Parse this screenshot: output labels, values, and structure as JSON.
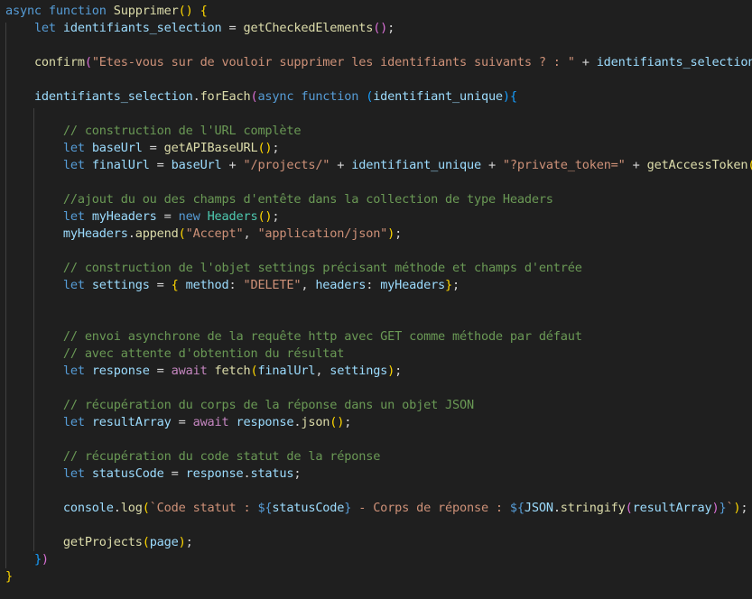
{
  "theme": {
    "background": "#1f1f1f",
    "keyword": "#569cd6",
    "control": "#c586c0",
    "function": "#dcdcaa",
    "variable": "#9cdcfe",
    "string": "#ce9178",
    "comment": "#6a9955",
    "class": "#4ec9b0",
    "bracket_1": "#ffd700",
    "bracket_2": "#da70d6",
    "bracket_3": "#179fff"
  },
  "code": {
    "lines": [
      {
        "indent": 0,
        "tokens": [
          {
            "t": "async",
            "c": "kw"
          },
          {
            "t": " "
          },
          {
            "t": "function",
            "c": "kw"
          },
          {
            "t": " "
          },
          {
            "t": "Supprimer",
            "c": "fn"
          },
          {
            "t": "()",
            "c": "b1"
          },
          {
            "t": " "
          },
          {
            "t": "{",
            "c": "b1"
          }
        ]
      },
      {
        "indent": 1,
        "tokens": [
          {
            "t": "let",
            "c": "kw"
          },
          {
            "t": " "
          },
          {
            "t": "identifiants_selection",
            "c": "var"
          },
          {
            "t": " = "
          },
          {
            "t": "getCheckedElements",
            "c": "fn"
          },
          {
            "t": "()",
            "c": "b2"
          },
          {
            "t": ";"
          }
        ]
      },
      {
        "indent": 0,
        "tokens": []
      },
      {
        "indent": 1,
        "tokens": [
          {
            "t": "confirm",
            "c": "fn"
          },
          {
            "t": "(",
            "c": "b2"
          },
          {
            "t": "\"Etes-vous sur de vouloir supprimer les identifiants suivants ? : \"",
            "c": "str"
          },
          {
            "t": " + "
          },
          {
            "t": "identifiants_selection",
            "c": "var"
          },
          {
            "t": ")",
            "c": "b2"
          },
          {
            "t": ";"
          }
        ]
      },
      {
        "indent": 0,
        "tokens": []
      },
      {
        "indent": 1,
        "tokens": [
          {
            "t": "identifiants_selection",
            "c": "var"
          },
          {
            "t": "."
          },
          {
            "t": "forEach",
            "c": "fn"
          },
          {
            "t": "(",
            "c": "b2"
          },
          {
            "t": "async",
            "c": "kw"
          },
          {
            "t": " "
          },
          {
            "t": "function",
            "c": "kw"
          },
          {
            "t": " "
          },
          {
            "t": "(",
            "c": "b3"
          },
          {
            "t": "identifiant_unique",
            "c": "var"
          },
          {
            "t": ")",
            "c": "b3"
          },
          {
            "t": "{",
            "c": "b3"
          }
        ]
      },
      {
        "indent": 0,
        "tokens": []
      },
      {
        "indent": 2,
        "tokens": [
          {
            "t": "// construction de l'URL complète",
            "c": "cm"
          }
        ]
      },
      {
        "indent": 2,
        "tokens": [
          {
            "t": "let",
            "c": "kw"
          },
          {
            "t": " "
          },
          {
            "t": "baseUrl",
            "c": "var"
          },
          {
            "t": " = "
          },
          {
            "t": "getAPIBaseURL",
            "c": "fn"
          },
          {
            "t": "()",
            "c": "b1"
          },
          {
            "t": ";"
          }
        ]
      },
      {
        "indent": 2,
        "tokens": [
          {
            "t": "let",
            "c": "kw"
          },
          {
            "t": " "
          },
          {
            "t": "finalUrl",
            "c": "var"
          },
          {
            "t": " = "
          },
          {
            "t": "baseUrl",
            "c": "var"
          },
          {
            "t": " + "
          },
          {
            "t": "\"/projects/\"",
            "c": "str"
          },
          {
            "t": " + "
          },
          {
            "t": "identifiant_unique",
            "c": "var"
          },
          {
            "t": " + "
          },
          {
            "t": "\"?private_token=\"",
            "c": "str"
          },
          {
            "t": " + "
          },
          {
            "t": "getAccessToken",
            "c": "fn"
          },
          {
            "t": "()",
            "c": "b1"
          },
          {
            "t": ";"
          }
        ]
      },
      {
        "indent": 0,
        "tokens": []
      },
      {
        "indent": 2,
        "tokens": [
          {
            "t": "//ajout du ou des champs d'entête dans la collection de type Headers",
            "c": "cm"
          }
        ]
      },
      {
        "indent": 2,
        "tokens": [
          {
            "t": "let",
            "c": "kw"
          },
          {
            "t": " "
          },
          {
            "t": "myHeaders",
            "c": "var"
          },
          {
            "t": " = "
          },
          {
            "t": "new",
            "c": "kw"
          },
          {
            "t": " "
          },
          {
            "t": "Headers",
            "c": "cls"
          },
          {
            "t": "()",
            "c": "b1"
          },
          {
            "t": ";"
          }
        ]
      },
      {
        "indent": 2,
        "tokens": [
          {
            "t": "myHeaders",
            "c": "var"
          },
          {
            "t": "."
          },
          {
            "t": "append",
            "c": "fn"
          },
          {
            "t": "(",
            "c": "b1"
          },
          {
            "t": "\"Accept\"",
            "c": "str"
          },
          {
            "t": ", "
          },
          {
            "t": "\"application/json\"",
            "c": "str"
          },
          {
            "t": ")",
            "c": "b1"
          },
          {
            "t": ";"
          }
        ]
      },
      {
        "indent": 0,
        "tokens": []
      },
      {
        "indent": 2,
        "tokens": [
          {
            "t": "// construction de l'objet settings précisant méthode et champs d'entrée",
            "c": "cm"
          }
        ]
      },
      {
        "indent": 2,
        "tokens": [
          {
            "t": "let",
            "c": "kw"
          },
          {
            "t": " "
          },
          {
            "t": "settings",
            "c": "var"
          },
          {
            "t": " = "
          },
          {
            "t": "{",
            "c": "b1"
          },
          {
            "t": " "
          },
          {
            "t": "method",
            "c": "var"
          },
          {
            "t": ": "
          },
          {
            "t": "\"DELETE\"",
            "c": "str"
          },
          {
            "t": ", "
          },
          {
            "t": "headers",
            "c": "var"
          },
          {
            "t": ": "
          },
          {
            "t": "myHeaders",
            "c": "var"
          },
          {
            "t": "}",
            "c": "b1"
          },
          {
            "t": ";"
          }
        ]
      },
      {
        "indent": 0,
        "tokens": []
      },
      {
        "indent": 0,
        "tokens": []
      },
      {
        "indent": 2,
        "tokens": [
          {
            "t": "// envoi asynchrone de la requête http avec GET comme méthode par défaut",
            "c": "cm"
          }
        ]
      },
      {
        "indent": 2,
        "tokens": [
          {
            "t": "// avec attente d'obtention du résultat",
            "c": "cm"
          }
        ]
      },
      {
        "indent": 2,
        "tokens": [
          {
            "t": "let",
            "c": "kw"
          },
          {
            "t": " "
          },
          {
            "t": "response",
            "c": "var"
          },
          {
            "t": " = "
          },
          {
            "t": "await",
            "c": "kc"
          },
          {
            "t": " "
          },
          {
            "t": "fetch",
            "c": "fn"
          },
          {
            "t": "(",
            "c": "b1"
          },
          {
            "t": "finalUrl",
            "c": "var"
          },
          {
            "t": ", "
          },
          {
            "t": "settings",
            "c": "var"
          },
          {
            "t": ")",
            "c": "b1"
          },
          {
            "t": ";"
          }
        ]
      },
      {
        "indent": 0,
        "tokens": []
      },
      {
        "indent": 2,
        "tokens": [
          {
            "t": "// récupération du corps de la réponse dans un objet JSON",
            "c": "cm"
          }
        ]
      },
      {
        "indent": 2,
        "tokens": [
          {
            "t": "let",
            "c": "kw"
          },
          {
            "t": " "
          },
          {
            "t": "resultArray",
            "c": "var"
          },
          {
            "t": " = "
          },
          {
            "t": "await",
            "c": "kc"
          },
          {
            "t": " "
          },
          {
            "t": "response",
            "c": "var"
          },
          {
            "t": "."
          },
          {
            "t": "json",
            "c": "fn"
          },
          {
            "t": "()",
            "c": "b1"
          },
          {
            "t": ";"
          }
        ]
      },
      {
        "indent": 0,
        "tokens": []
      },
      {
        "indent": 2,
        "tokens": [
          {
            "t": "// récupération du code statut de la réponse",
            "c": "cm"
          }
        ]
      },
      {
        "indent": 2,
        "tokens": [
          {
            "t": "let",
            "c": "kw"
          },
          {
            "t": " "
          },
          {
            "t": "statusCode",
            "c": "var"
          },
          {
            "t": " = "
          },
          {
            "t": "response",
            "c": "var"
          },
          {
            "t": "."
          },
          {
            "t": "status",
            "c": "var"
          },
          {
            "t": ";"
          }
        ]
      },
      {
        "indent": 0,
        "tokens": []
      },
      {
        "indent": 2,
        "tokens": [
          {
            "t": "console",
            "c": "var"
          },
          {
            "t": "."
          },
          {
            "t": "log",
            "c": "fn"
          },
          {
            "t": "(",
            "c": "b1"
          },
          {
            "t": "`Code statut : ",
            "c": "str"
          },
          {
            "t": "${",
            "c": "kw"
          },
          {
            "t": "statusCode",
            "c": "var"
          },
          {
            "t": "}",
            "c": "kw"
          },
          {
            "t": " - Corps de réponse : ",
            "c": "str"
          },
          {
            "t": "${",
            "c": "kw"
          },
          {
            "t": "JSON",
            "c": "var"
          },
          {
            "t": "."
          },
          {
            "t": "stringify",
            "c": "fn"
          },
          {
            "t": "(",
            "c": "b2"
          },
          {
            "t": "resultArray",
            "c": "var"
          },
          {
            "t": ")",
            "c": "b2"
          },
          {
            "t": "}",
            "c": "kw"
          },
          {
            "t": "`",
            "c": "str"
          },
          {
            "t": ")",
            "c": "b1"
          },
          {
            "t": ";"
          }
        ]
      },
      {
        "indent": 0,
        "tokens": []
      },
      {
        "indent": 2,
        "tokens": [
          {
            "t": "getProjects",
            "c": "fn"
          },
          {
            "t": "(",
            "c": "b1"
          },
          {
            "t": "page",
            "c": "var"
          },
          {
            "t": ")",
            "c": "b1"
          },
          {
            "t": ";"
          }
        ]
      },
      {
        "indent": 1,
        "tokens": [
          {
            "t": "}",
            "c": "b3"
          },
          {
            "t": ")",
            "c": "b2"
          }
        ]
      },
      {
        "indent": 0,
        "tokens": [
          {
            "t": "}",
            "c": "b1"
          }
        ]
      }
    ]
  }
}
